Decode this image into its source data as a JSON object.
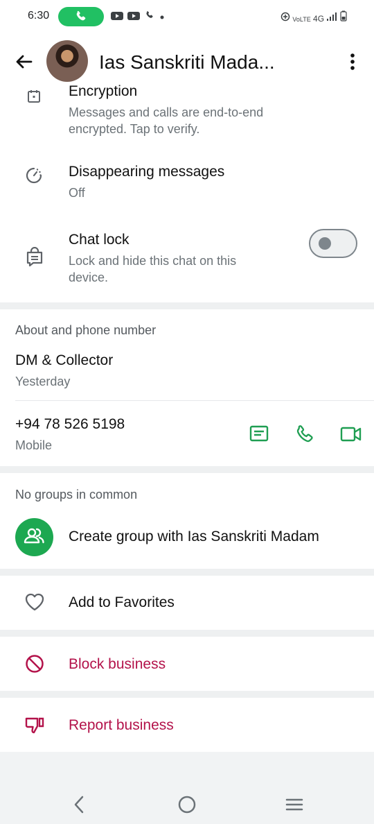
{
  "status_bar": {
    "time": "6:30",
    "network": "4G"
  },
  "header": {
    "contact_name": "Ias Sanskriti Mada..."
  },
  "encryption": {
    "title": "Encryption",
    "subtitle_line1": "Messages and calls are end-to-end",
    "subtitle_line2": "encrypted. Tap to verify."
  },
  "disappearing": {
    "title": "Disappearing messages",
    "value": "Off"
  },
  "chat_lock": {
    "title": "Chat lock",
    "subtitle_line1": "Lock and hide this chat on this",
    "subtitle_line2": "device.",
    "enabled": false
  },
  "about": {
    "section_title": "About and phone number",
    "about_text": "DM & Collector",
    "about_date": "Yesterday",
    "phone": "+94 78 526 5198",
    "phone_type": "Mobile"
  },
  "groups": {
    "section_title": "No groups in common",
    "create_label": "Create group with Ias Sanskriti Madam"
  },
  "actions": {
    "favorites": "Add to Favorites",
    "block": "Block business",
    "report": "Report business"
  },
  "colors": {
    "accent_green": "#1f9e52",
    "danger_red": "#b3124a"
  }
}
